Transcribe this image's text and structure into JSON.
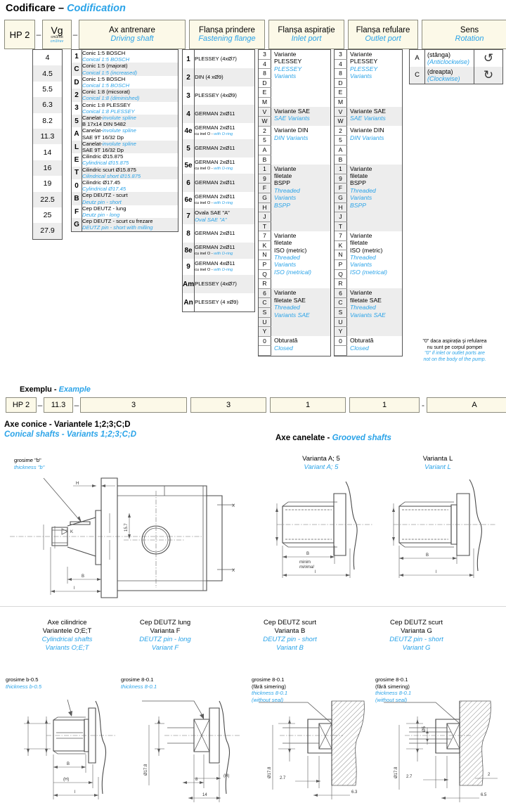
{
  "title": {
    "ro": "Codificare",
    "sep": "–",
    "en": "Codification"
  },
  "header": {
    "model": "HP 2",
    "vg": {
      "symbol": "Vg",
      "unit_ro": "cm3/rot",
      "unit_en": "cm3/rev"
    },
    "columns": [
      {
        "ro": "Ax antrenare",
        "en": "Driving shaft"
      },
      {
        "ro": "Flanșa prindere",
        "en": "Fastening flange"
      },
      {
        "ro": "Flanșa aspirație",
        "en": "Inlet port"
      },
      {
        "ro": "Flanșa refulare",
        "en": "Outlet port"
      },
      {
        "ro": "Sens",
        "en": "Rotation"
      }
    ],
    "dash": "–"
  },
  "vg_values": [
    "4",
    "4.5",
    "5.5",
    "6.3",
    "8.2",
    "11.3",
    "14",
    "16",
    "19",
    "22.5",
    "25",
    "27.9"
  ],
  "shaft_options": [
    {
      "code": "1",
      "l1_ro": "Conic 1:5   BOSCH",
      "l2_en": "Conical 1:5 BOSCH"
    },
    {
      "code": "C",
      "l1_ro": "Conic 1:5  (majorat)",
      "l2_en": "Conical 1:5 (increased)"
    },
    {
      "code": "D",
      "l1_ro": "Conic 1:5   BOSCH",
      "l2_en": "Conical 1:5 BOSCH"
    },
    {
      "code": "2",
      "l1_ro": "Conic 1:8  (micsorat)",
      "l2_en": "Conical 1:8 (diminished)"
    },
    {
      "code": "3",
      "l1_ro": "Conic 1:8  PLESSEY",
      "l2_en": "Conical 1:8 PLESSEY"
    },
    {
      "code": "5",
      "l1_ro": "Canelat-",
      "l1_en": "involute spline",
      "l2_ro": "B 17x14   DIN 5482"
    },
    {
      "code": "A",
      "l1_ro": "Canelat-",
      "l1_en": "involute spline",
      "l2_ro": "SAE  9T 16/32 Dp"
    },
    {
      "code": "L",
      "l1_ro": "Canelat-",
      "l1_en": "involute spline",
      "l2_ro": "SAE  9T 16/32 Dp"
    },
    {
      "code": "E",
      "l1_ro": "Cilindric     Ø15.875",
      "l2_en": "Cylindrical  Ø15.875"
    },
    {
      "code": "T",
      "l1_ro": "Cilindric scurt Ø15.875",
      "l2_en": "Cilindrical short Ø15.875"
    },
    {
      "code": "0",
      "l1_ro": "Cilindric     Ø17.45",
      "l2_en": "Cylindrical  Ø17.45"
    },
    {
      "code": "B",
      "l1_ro": "Cep DEUTZ - scurt",
      "l2_en": "Deutz pin - short"
    },
    {
      "code": "F",
      "l1_ro": "Cep DEUTZ - lung",
      "l2_en": "Deutz pin - long"
    },
    {
      "code": "G",
      "l1_ro": "Cep DEUTZ - scurt cu frezare",
      "l2_en": "DEUTZ pin - short with milling"
    }
  ],
  "flange_options": [
    {
      "code": "1",
      "l1_ro": "PLESSEY (4xØ7)",
      "l2_ro": "",
      "l2_en": ""
    },
    {
      "code": "2",
      "l1_ro": "DIN   (4 xØ9)",
      "l2_ro": "",
      "l2_en": ""
    },
    {
      "code": "3",
      "l1_ro": "PLESSEY (4xØ9)",
      "l2_ro": "",
      "l2_en": ""
    },
    {
      "code": "4",
      "l1_ro": "GERMAN  2xØ11",
      "l2_ro": "",
      "l2_en": ""
    },
    {
      "code": "4e",
      "l1_ro": "GERMAN  2xØ11",
      "l2_ro": "cu inel O - ",
      "l2_en": "with O-ring"
    },
    {
      "code": "5",
      "l1_ro": "GERMAN  2xØ11",
      "l2_ro": "",
      "l2_en": ""
    },
    {
      "code": "5e",
      "l1_ro": "GERMAN  2xØ11",
      "l2_ro": "cu inel O - ",
      "l2_en": "with O-ring"
    },
    {
      "code": "6",
      "l1_ro": "GERMAN  2xØ11",
      "l2_ro": "",
      "l2_en": ""
    },
    {
      "code": "6e",
      "l1_ro": "GERMAN  2xØ11",
      "l2_ro": "cu inel O - ",
      "l2_en": "with O-ring"
    },
    {
      "code": "7",
      "l1_ro": "Ovala SAE \"A\"",
      "l2_en": "Oval  SAE \"A\""
    },
    {
      "code": "8",
      "l1_ro": "GERMAN  2xØ11",
      "l2_ro": "",
      "l2_en": ""
    },
    {
      "code": "8e",
      "l1_ro": "GERMAN  2xØ11",
      "l2_ro": "cu inel O - ",
      "l2_en": "with O-ring"
    },
    {
      "code": "9",
      "l1_ro": "GERMAN  4xØ11",
      "l2_ro": "cu inel O - ",
      "l2_en": "with O-ring"
    },
    {
      "code": "Am",
      "l1_ro": "PLESSEY (4xØ7)",
      "l2_ro": "",
      "l2_en": ""
    },
    {
      "code": "An",
      "l1_ro": "PLESSEY (4 xØ9)",
      "l2_ro": "",
      "l2_en": ""
    }
  ],
  "port_groups": [
    {
      "codes": [
        "3",
        "4",
        "8",
        "D",
        "E",
        "M"
      ],
      "lines_ro": [
        "Variante",
        "PLESSEY"
      ],
      "lines_en": [
        "PLESSEY",
        "Variants"
      ],
      "shaded": false
    },
    {
      "codes": [
        "V",
        "W"
      ],
      "lines_ro": [
        "Variante SAE"
      ],
      "lines_en": [
        "SAE Variants"
      ],
      "shaded": true
    },
    {
      "codes": [
        "2",
        "5",
        "A",
        "B"
      ],
      "lines_ro": [
        "Variante DIN"
      ],
      "lines_en": [
        "DIN Variants"
      ],
      "shaded": false
    },
    {
      "codes": [
        "1",
        "9",
        "F",
        "G",
        "H",
        "J",
        "T"
      ],
      "lines_ro": [
        "Variante",
        "filetate",
        "BSPP"
      ],
      "lines_en": [
        "Threaded",
        "Variants",
        "BSPP"
      ],
      "shaded": true
    },
    {
      "codes": [
        "7",
        "K",
        "N",
        "P",
        "Q",
        "R"
      ],
      "lines_ro": [
        "Variante",
        "filetate",
        "ISO (metric)"
      ],
      "lines_en": [
        "Threaded",
        "Variants",
        "ISO (metrical)"
      ],
      "shaded": false
    },
    {
      "codes": [
        "6",
        "C",
        "S",
        "U",
        "Y"
      ],
      "lines_ro": [
        "Variante",
        "filetate SAE"
      ],
      "lines_en": [
        "Threaded",
        "Variants SAE"
      ],
      "shaded": true
    },
    {
      "codes": [
        "0"
      ],
      "lines_ro": [
        "Obturată"
      ],
      "lines_en": [
        "Closed"
      ],
      "shaded": false
    }
  ],
  "rotation_options": [
    {
      "code": "A",
      "ro": "(stânga)",
      "en": "(Anticlockwise)",
      "icon": "rotate-ccw-icon"
    },
    {
      "code": "C",
      "ro": "(dreapta)",
      "en": "(Clockwise)",
      "icon": "rotate-cw-icon"
    }
  ],
  "footnote": {
    "ro_l1": "\"0\" daca aspirația şi refularea",
    "ro_l2": "nu sunt pe corpul pompei",
    "en_l1": "\"0\" if inlet or outlet ports are",
    "en_l2": "not on the body of the pump."
  },
  "example": {
    "label_ro": "Exemplu -",
    "label_en": "Example",
    "cells": [
      "HP 2",
      "11.3",
      "3",
      "3",
      "1",
      "1",
      "A"
    ],
    "dash1": "–",
    "dash2": "–",
    "dash3": "-"
  },
  "sections": {
    "conical": {
      "ro": "Axe conice - Variantele 1;2;3;C;D",
      "en": "Conical shafts - Variants 1;2;3;C;D",
      "note_ro": "grosime \"b\"",
      "note_en": "thickness \"b\"",
      "dims": {
        "H": "H",
        "K": "K",
        "B": "B",
        "l": "l",
        "center": "15.7",
        "x1": "X",
        "x2": "X"
      }
    },
    "grooved": {
      "ro": "Axe canelate -",
      "en": "Grooved shafts",
      "variants": [
        {
          "ro": "Varianta A; 5",
          "en": "Variant A; 5",
          "dim_B": "B",
          "dim_l": "l",
          "sub_ro": "minim",
          "sub_en": "minimal"
        },
        {
          "ro": "Varianta L",
          "en": "Variant L",
          "dim_B": "B",
          "dim_l": "l"
        }
      ]
    },
    "bottom": [
      {
        "ro_l1": "Axe cilindrice",
        "ro_l2": "Variantele     O;E;T",
        "en_l1": "Cylindrical shafts",
        "en_l2": "Variants        O;E;T",
        "note_ro": "grosime b-0.5",
        "note_en": "thickness b-0.5",
        "dims": [
          "B",
          "(H)",
          "l"
        ]
      },
      {
        "ro_l1": "Cep DEUTZ  lung",
        "ro_l2": "Varianta  F",
        "en_l1": "DEUTZ pin - long",
        "en_l2": "Variant F",
        "note_ro": "grosime 8-0.1",
        "note_en": "thickness 8-0.1",
        "dims": [
          "Ø17.8",
          "(H)",
          "8",
          "14"
        ]
      },
      {
        "ro_l1": "Cep DEUTZ  scurt",
        "ro_l2": "Varianta  B",
        "en_l1": "DEUTZ pin - short",
        "en_l2": "Variant B",
        "note_ro": "grosime 8-0.1",
        "note_ro2": "(fără simering)",
        "note_en": "thickness 8-0.1",
        "note_en2": "(without seal)",
        "dims": [
          "Ø17.8",
          "2.7",
          "6.3"
        ]
      },
      {
        "ro_l1": "Cep DEUTZ  scurt",
        "ro_l2": "Varianta  G",
        "en_l1": "DEUTZ pin - short",
        "en_l2": "Variant G",
        "note_ro": "grosime 8-0.1",
        "note_ro2": "(fără simering)",
        "note_en": "thickness 8-0.1",
        "note_en2": "(without seal)",
        "dims": [
          "Ø17.8",
          "Ø5",
          "2.7",
          "2",
          "6.5"
        ]
      }
    ]
  },
  "colors": {
    "accent": "#2AA3E8",
    "box_bg": "#FCF9E8",
    "box_border": "#8c8c7e",
    "alt_row": "#EDEDED"
  }
}
